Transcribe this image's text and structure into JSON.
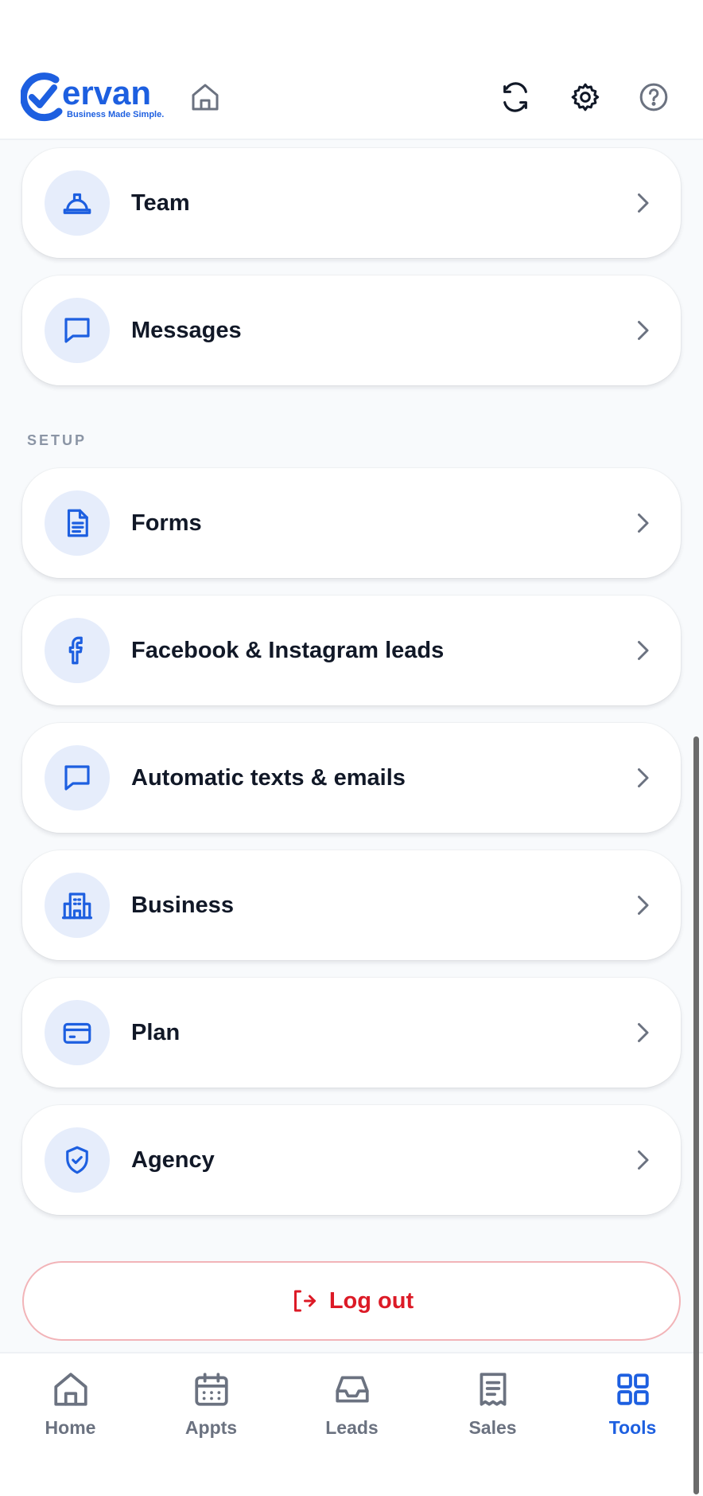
{
  "header": {
    "logo_text": "Cervan",
    "logo_tagline": "Business Made Simple."
  },
  "colors": {
    "brand_blue": "#1d5fe0",
    "icon_circle": "#e6edfb",
    "logout_red": "#dc1a26",
    "logout_border": "#f2b4b8"
  },
  "menu": {
    "team": "Team",
    "messages": "Messages"
  },
  "setup": {
    "section_title": "SETUP",
    "forms": "Forms",
    "facebook": "Facebook & Instagram leads",
    "automatic": "Automatic texts & emails",
    "business": "Business",
    "plan": "Plan",
    "agency": "Agency"
  },
  "logout_label": "Log out",
  "nav": {
    "home": "Home",
    "appts": "Appts",
    "leads": "Leads",
    "sales": "Sales",
    "tools": "Tools",
    "active": "tools"
  }
}
